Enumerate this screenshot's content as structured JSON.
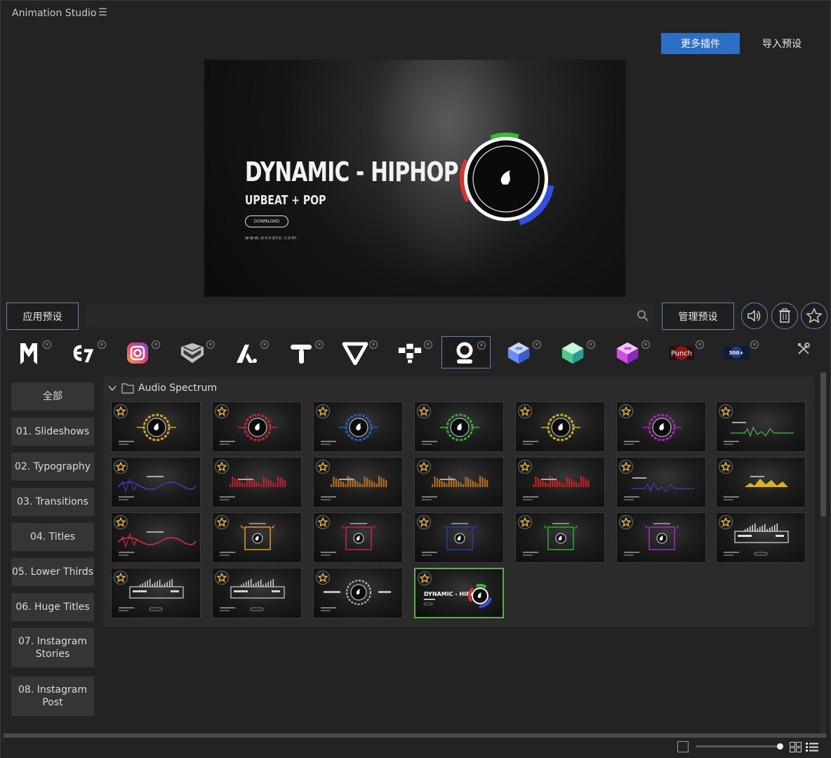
{
  "app": {
    "title": "Animation Studio",
    "menu_icon": "hamburger-menu-icon"
  },
  "header": {
    "more_plugins": "更多插件",
    "import_presets": "导入预设"
  },
  "preview": {
    "title": "DYNAMIC - HIPHOP",
    "subtitle": "UPBEAT + POP",
    "button": "DOWNLOAD",
    "url": "www.envato.com"
  },
  "toolbar": {
    "apply_preset": "应用预设",
    "search_value": "",
    "manage_presets": "管理预设",
    "icons": [
      "speaker-icon",
      "trash-icon",
      "star-icon"
    ]
  },
  "plugins": [
    {
      "name": "m-logo",
      "label": "M"
    },
    {
      "name": "e7-logo",
      "label": "E7"
    },
    {
      "name": "instagram-logo",
      "label": ""
    },
    {
      "name": "chevron-badge-logo",
      "label": ""
    },
    {
      "name": "a-logo",
      "label": "A"
    },
    {
      "name": "t-logo",
      "label": "T"
    },
    {
      "name": "v-logo",
      "label": "V"
    },
    {
      "name": "nodes-logo",
      "label": ""
    },
    {
      "name": "q-logo",
      "label": ""
    },
    {
      "name": "blue-cube-logo",
      "label": ""
    },
    {
      "name": "green-cube-logo",
      "label": ""
    },
    {
      "name": "pink-cube-logo",
      "label": ""
    },
    {
      "name": "punch-logo",
      "label": "Punch"
    },
    {
      "name": "transitions-logo",
      "label": "300+"
    }
  ],
  "categories": [
    {
      "label": "全部"
    },
    {
      "label": "01. Slideshows"
    },
    {
      "label": "02. Typography"
    },
    {
      "label": "03. Transitions"
    },
    {
      "label": "04. Titles"
    },
    {
      "label": "05. Lower Thirds"
    },
    {
      "label": "06. Huge Titles"
    },
    {
      "label": "07. Instagram Stories"
    },
    {
      "label": "08. Instagram Post"
    }
  ],
  "folder": {
    "name": "Audio Spectrum"
  },
  "presets": [
    {
      "style": "ring",
      "color": "#e0a020"
    },
    {
      "style": "ring",
      "color": "#d02030"
    },
    {
      "style": "ring",
      "color": "#2060c0"
    },
    {
      "style": "ring",
      "color": "#30b030"
    },
    {
      "style": "ring",
      "color": "#c8b020"
    },
    {
      "style": "ring",
      "color": "#b020c0"
    },
    {
      "style": "line",
      "color": "#40c040"
    },
    {
      "style": "wave",
      "color": "#5a30c0"
    },
    {
      "style": "bars",
      "color": "#c02030"
    },
    {
      "style": "bars",
      "color": "#c07020"
    },
    {
      "style": "bars",
      "color": "#c07020"
    },
    {
      "style": "bars",
      "color": "#d02020"
    },
    {
      "style": "line",
      "color": "#5a30c0"
    },
    {
      "style": "mountain",
      "color": "#e0b020"
    },
    {
      "style": "wave",
      "color": "#e03040"
    },
    {
      "style": "box",
      "color": "#e0a020"
    },
    {
      "style": "box",
      "color": "#d02040"
    },
    {
      "style": "box",
      "color": "#2040b0"
    },
    {
      "style": "box",
      "color": "#30b030"
    },
    {
      "style": "box",
      "color": "#a030c0"
    },
    {
      "style": "frame",
      "color": "#e0e0e0"
    },
    {
      "style": "frame",
      "color": "#d0d0d0"
    },
    {
      "style": "frame",
      "color": "#d0d0d0"
    },
    {
      "style": "ringframe",
      "color": "#c0c0c0"
    },
    {
      "style": "hiphop",
      "color": "#ffffff"
    }
  ],
  "selected_index": 24,
  "footer": {
    "icons": [
      "fit-icon",
      "grid-view-icon",
      "list-view-icon"
    ],
    "zoom_level": 1.0
  }
}
